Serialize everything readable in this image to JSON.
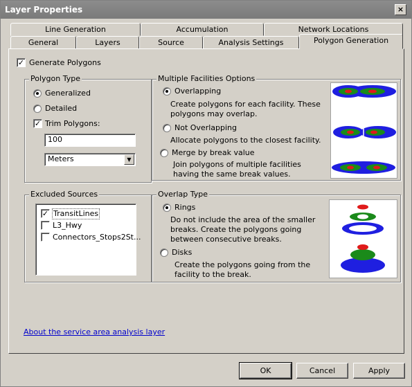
{
  "window": {
    "title": "Layer Properties",
    "close_glyph": "×"
  },
  "tabs_back": [
    {
      "label": "Line Generation"
    },
    {
      "label": "Accumulation"
    },
    {
      "label": "Network Locations"
    }
  ],
  "tabs_front": [
    {
      "label": "General"
    },
    {
      "label": "Layers"
    },
    {
      "label": "Source"
    },
    {
      "label": "Analysis Settings"
    },
    {
      "label": "Polygon Generation",
      "selected": true
    }
  ],
  "generate_polygons": {
    "label": "Generate Polygons",
    "checked": true
  },
  "polygon_type": {
    "title": "Polygon Type",
    "generalized": "Generalized",
    "detailed": "Detailed",
    "trim_label": "Trim Polygons:",
    "trim_value": "100",
    "units_value": "Meters"
  },
  "multiple_facilities": {
    "title": "Multiple Facilities Options",
    "overlapping": {
      "label": "Overlapping",
      "desc": "Create polygons for each facility. These polygons may overlap."
    },
    "not_overlapping": {
      "label": "Not Overlapping",
      "desc": "Allocate polygons to the closest facility."
    },
    "merge": {
      "label": "Merge by break value",
      "desc": "Join polygons of multiple facilities having the same break values."
    }
  },
  "excluded_sources": {
    "title": "Excluded Sources",
    "items": [
      {
        "label": "TransitLines",
        "checked": true
      },
      {
        "label": "L3_Hwy",
        "checked": false
      },
      {
        "label": "Connectors_Stops2St...",
        "checked": false
      }
    ]
  },
  "overlap_type": {
    "title": "Overlap Type",
    "rings": {
      "label": "Rings",
      "desc": "Do not include the area of the smaller breaks. Create the polygons going between consecutive breaks."
    },
    "disks": {
      "label": "Disks",
      "desc": "Create the polygons going from the facility to the break."
    }
  },
  "about_link": "About the service area analysis layer",
  "buttons": {
    "ok": "OK",
    "cancel": "Cancel",
    "apply": "Apply"
  },
  "colors": {
    "blue": "#1f1fe0",
    "green": "#1a8a1a",
    "red": "#e01a1a"
  }
}
